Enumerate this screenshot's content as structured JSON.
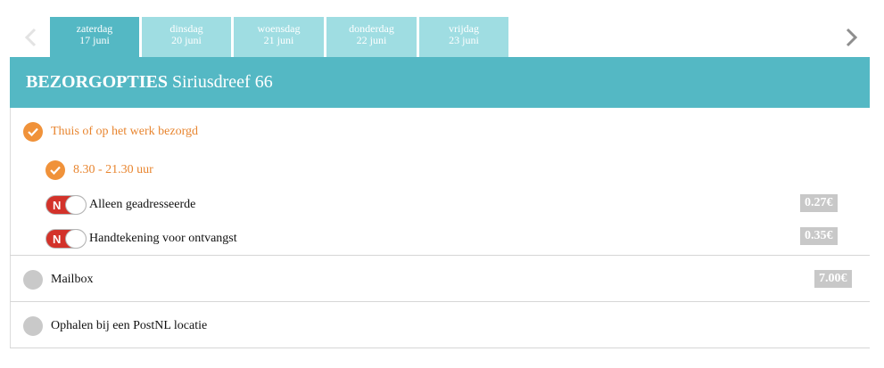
{
  "tabs": [
    {
      "day": "zaterdag",
      "date": "17 juni",
      "active": true
    },
    {
      "day": "dinsdag",
      "date": "20 juni",
      "active": false
    },
    {
      "day": "woensdag",
      "date": "21 juni",
      "active": false
    },
    {
      "day": "donderdag",
      "date": "22 juni",
      "active": false
    },
    {
      "day": "vrijdag",
      "date": "23 juni",
      "active": false
    }
  ],
  "header": {
    "title_bold": "BEZORGOPTIES",
    "address": "Siriusdreef 66"
  },
  "options": {
    "home": {
      "label": "Thuis of op het werk bezorgd",
      "selected": true
    },
    "timeslot": {
      "label": "8.30 - 21.30 uur",
      "selected": true
    },
    "only_addressee": {
      "toggle": "N",
      "label": "Alleen geadresseerde",
      "price": "0.27€"
    },
    "signature": {
      "toggle": "N",
      "label": "Handtekening voor ontvangst",
      "price": "0.35€"
    },
    "mailbox": {
      "label": "Mailbox",
      "price": "7.00€",
      "selected": false
    },
    "pickup": {
      "label": "Ophalen bij een PostNL locatie",
      "selected": false
    }
  },
  "colors": {
    "accent": "#54b8c4",
    "tab_inactive": "#9fdde2",
    "orange": "#f0923a",
    "toggle_off": "#d3322a",
    "price_bg": "#c8c8c8"
  },
  "icons": {
    "prev": "chevron-left-icon",
    "next": "chevron-right-icon",
    "check": "check-icon"
  }
}
